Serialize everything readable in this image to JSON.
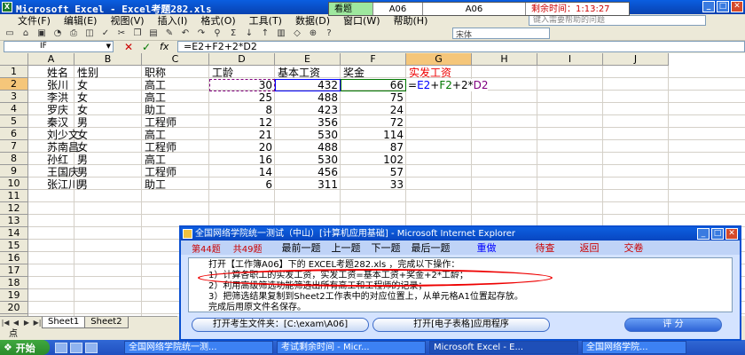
{
  "window": {
    "title": "Microsoft Excel - Excel考题282.xls",
    "app_icon": "X"
  },
  "timer": {
    "label_exam": "看题",
    "question_id": "A06",
    "question_id2": "A06",
    "remaining_label": "剩余时间：1:13:27"
  },
  "menu": [
    "文件(F)",
    "编辑(E)",
    "视图(V)",
    "插入(I)",
    "格式(O)",
    "工具(T)",
    "数据(D)",
    "窗口(W)",
    "帮助(H)"
  ],
  "help_placeholder": "键入需要帮助的问题",
  "font_name": "宋体",
  "name_box": "IF",
  "formula": "=E2+F2+2*D2",
  "columns": [
    "A",
    "B",
    "C",
    "D",
    "E",
    "F",
    "G",
    "H",
    "I",
    "J"
  ],
  "rows": [
    "1",
    "2",
    "3",
    "4",
    "5",
    "6",
    "7",
    "8",
    "9",
    "10",
    "11",
    "12",
    "13",
    "14",
    "15",
    "16",
    "17",
    "18",
    "19",
    "20",
    "21",
    "22"
  ],
  "headers": {
    "name": "姓名",
    "gender": "性别",
    "title": "职称",
    "years": "工龄",
    "base": "基本工资",
    "bonus": "奖金",
    "actual": "实发工资"
  },
  "table": [
    {
      "name": "张川",
      "gender": "女",
      "title": "高工",
      "years": "30",
      "base": "432",
      "bonus": "66"
    },
    {
      "name": "李洪",
      "gender": "女",
      "title": "高工",
      "years": "25",
      "base": "488",
      "bonus": "75"
    },
    {
      "name": "罗庆",
      "gender": "女",
      "title": "助工",
      "years": "8",
      "base": "423",
      "bonus": "24"
    },
    {
      "name": "秦汉",
      "gender": "男",
      "title": "工程师",
      "years": "12",
      "base": "356",
      "bonus": "72"
    },
    {
      "name": "刘少文",
      "gender": "女",
      "title": "高工",
      "years": "21",
      "base": "530",
      "bonus": "114"
    },
    {
      "name": "苏南昌",
      "gender": "女",
      "title": "工程师",
      "years": "20",
      "base": "488",
      "bonus": "87"
    },
    {
      "name": "孙红",
      "gender": "男",
      "title": "高工",
      "years": "16",
      "base": "530",
      "bonus": "102"
    },
    {
      "name": "王国庆",
      "gender": "男",
      "title": "工程师",
      "years": "14",
      "base": "456",
      "bonus": "57"
    },
    {
      "name": "张江川",
      "gender": "男",
      "title": "助工",
      "years": "6",
      "base": "311",
      "bonus": "33"
    }
  ],
  "editing_formula": {
    "prefix": "=",
    "r1": "E2",
    "plus1": "+",
    "r2": "F2",
    "plus2": "+2*",
    "r3": "D2"
  },
  "sheet_tabs": [
    "Sheet1",
    "Sheet2"
  ],
  "status": "点",
  "taskbar": {
    "start": "开始",
    "items": [
      "全国网络学院统一测...",
      "考试剩余时间 - Micr...",
      "Microsoft Excel - E...",
      "全国网络学院..."
    ]
  },
  "dialog": {
    "title": "全国网络学院统一测试（中山）[计算机应用基础] - Microsoft Internet Explorer",
    "question_no": "第44题",
    "total": "共49题",
    "nav": [
      "最前一题",
      "上一题",
      "下一题",
      "最后一题"
    ],
    "redo": "重做",
    "wait": "待查",
    "back": "返回",
    "submit": "交卷",
    "lines": [
      "打开【工作簿A06】下的 EXCEL考题282.xls ，完成以下操作：",
      "1）计算各职工的实发工资，实发工资=基本工资+奖金+2*工龄；",
      "2）利用高级筛选功能筛选出所有高工和工程师的记录；",
      "3）把筛选结果复制到Sheet2工作表中的对应位置上，从单元格A1位置起存放。",
      "完成后用原文件名保存。"
    ],
    "btn_open_folder": "打开考生文件夹：[C:\\exam\\A06]",
    "btn_open_app": "打开[电子表格]应用程序",
    "btn_score": "评 分"
  }
}
